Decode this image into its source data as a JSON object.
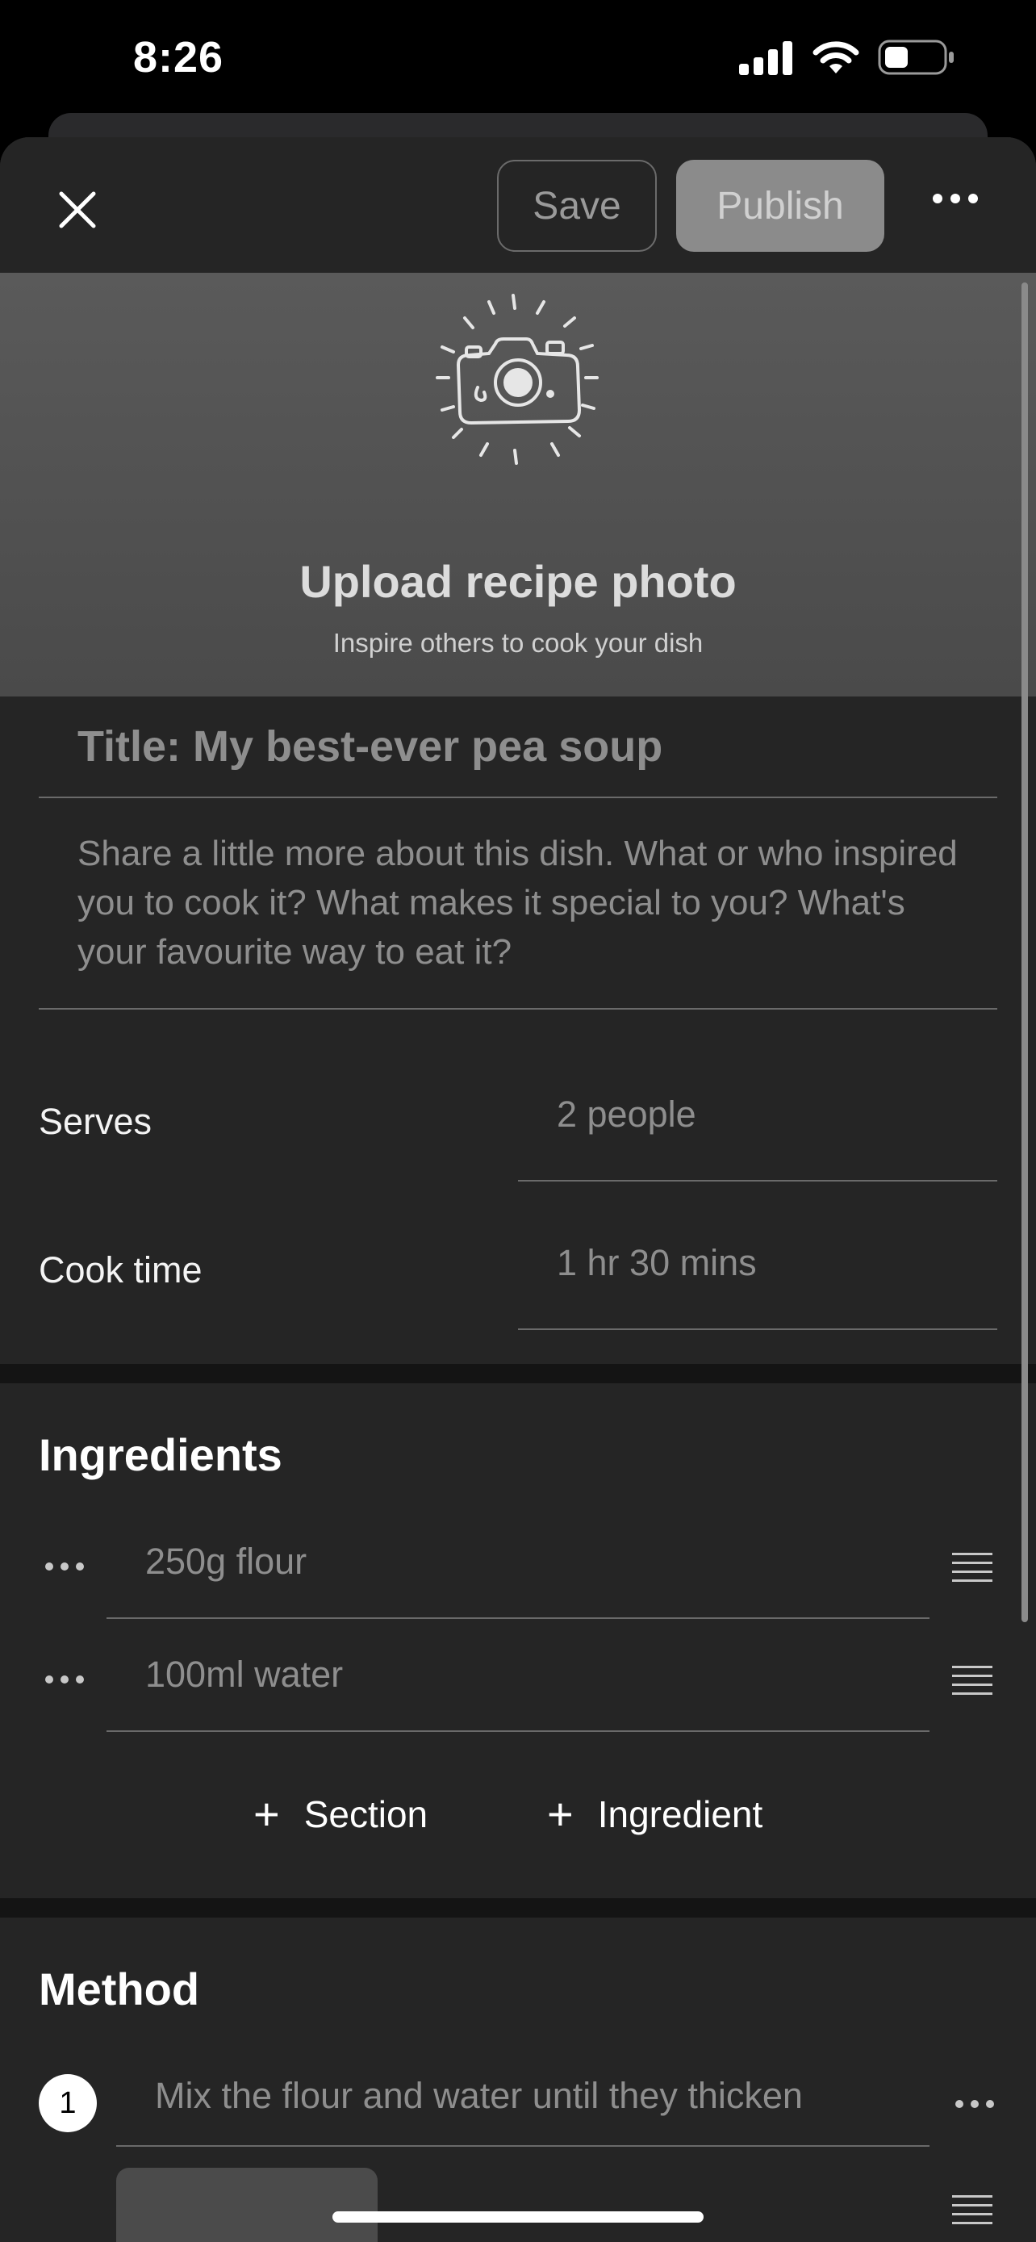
{
  "status_bar": {
    "time": "8:26"
  },
  "toolbar": {
    "save_label": "Save",
    "publish_label": "Publish"
  },
  "photo_upload": {
    "title": "Upload recipe photo",
    "subtitle": "Inspire others to cook your dish"
  },
  "form": {
    "title_placeholder": "Title: My best-ever pea soup",
    "description_placeholder": "Share a little more about this dish. What or who inspired you to cook it? What makes it special to you? What's your favourite way to eat it?",
    "serves_label": "Serves",
    "serves_placeholder": "2 people",
    "cook_time_label": "Cook time",
    "cook_time_placeholder": "1 hr 30 mins"
  },
  "ingredients": {
    "heading": "Ingredients",
    "items": [
      {
        "placeholder": "250g flour"
      },
      {
        "placeholder": "100ml water"
      }
    ],
    "add_section_label": "Section",
    "add_ingredient_label": "Ingredient"
  },
  "method": {
    "heading": "Method",
    "steps": [
      {
        "number": "1",
        "placeholder": "Mix the flour and water until they thicken"
      }
    ]
  },
  "icons": [
    "close-icon",
    "more-icon",
    "camera-icon",
    "plus-icon",
    "drag-handle-icon",
    "signal-icon",
    "wifi-icon",
    "battery-icon"
  ]
}
